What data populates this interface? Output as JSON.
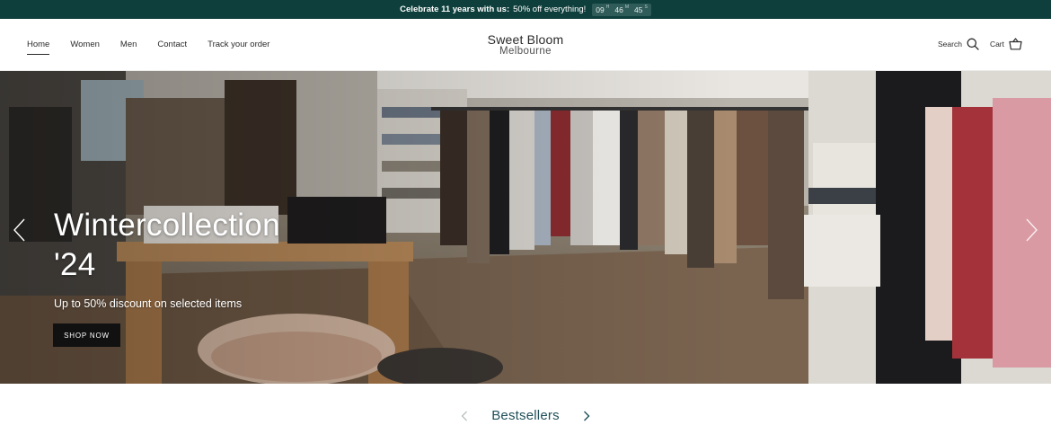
{
  "announcement": {
    "bold_text": "Celebrate 11 years with us:",
    "text": "50% off everything!",
    "countdown": [
      {
        "value": "09",
        "unit": "H"
      },
      {
        "value": "46",
        "unit": "M"
      },
      {
        "value": "45",
        "unit": "S"
      }
    ]
  },
  "nav": {
    "items": [
      "Home",
      "Women",
      "Men",
      "Contact",
      "Track your order"
    ],
    "active": "Home"
  },
  "logo": {
    "line1": "Sweet Bloom",
    "line2": "Melbourne"
  },
  "header_actions": {
    "search_label": "Search",
    "cart_label": "Cart"
  },
  "hero": {
    "title_line1": "Wintercollection",
    "title_line2": "'24",
    "subtitle": "Up to 50% discount on selected items",
    "button_label": "SHOP NOW"
  },
  "bestsellers": {
    "title": "Bestsellers"
  },
  "colors": {
    "announcement_bg": "#0e3f3c",
    "section_title": "#1f4f58",
    "button_bg": "#111111"
  }
}
